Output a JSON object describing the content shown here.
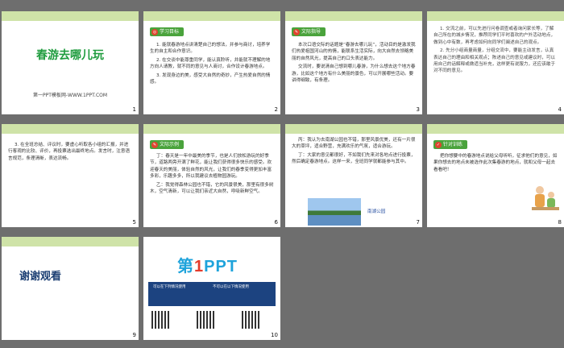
{
  "slides": [
    {
      "num": "1",
      "title": "春游去哪儿玩",
      "subtitle": "第一PPT模板网-WWW.1PPT.COM"
    },
    {
      "num": "2",
      "badge": "学习目标",
      "paras": [
        "1. 能就春游地点讲清楚自己的想法，并参与商讨，培养学生的自主和合作意识。",
        "2. 在交谈中能尊重同学，能认真聆听，并能就不理解的地方向人请教，就不同的意见与人商讨，合作设计春游地点。",
        "3. 发现身边的美，感受大自然的奇妙，产生热爱自然的情感。"
      ]
    },
    {
      "num": "3",
      "badge": "文际指导",
      "paras": [
        "本次口语交际的话题是“春游去哪儿玩”，活动目的是激发我们热爱祖国河山的热情，能联系生活实际，向大自然去领略美丽的自然风光，提高自己的口头表达能力。",
        "交流时，要说清自己想到哪儿春游，为什么想去这个地方春游，比如这个地方有什么美丽的景色，可以开展哪些活动。要讲得细致，有条理。"
      ]
    },
    {
      "num": "4",
      "paras": [
        "1. 交流之前，可以先进行问卷调查或者询问家长等，了解自己所在的城乡情况，推荐同学们平时喜欢的户外活动地点，做到心中有数，再考虑如何向同学们阐述自己的观点。",
        "2. 先分小组商量商量，分组交流中，要能主动发言，认真表达自己的理由和相关观点；陈述自己的意见或建议时，可以用自己的话解释或做适当补充，这样更有说服力，还应该敢于对不同的意见。"
      ]
    },
    {
      "num": "5",
      "paras": [
        "3. 在全班总结、评议时，要虚心听取各小组的汇报，并进行客观的比较、评价，再投票选出最终地点。发言时，注意语言规范，条理清晰，表达流畅。"
      ]
    },
    {
      "num": "6",
      "badge": "文际示例",
      "paras": [
        "丁：春天是一年中最美的季节，也是人们放松游玩的好季节，道路两旁开满了鲜花，能让我们获得很多快乐的感受。欢迎春天的美丽，体验自然的风光，让我们的春季变得更加丰富多彩，乐趣多多，所以我建议去植物园游玩。",
        "乙：我觉得森林公园也不错，它的风景很美，那里有很多树木，空气清新，可以让我们亲近大自然，呼吸新鲜空气。"
      ]
    },
    {
      "num": "7",
      "paras": [
        "丙：我认为去南湖公园也不错，那里风景优美，还有一片很大的草坪，适合野营，充满欢乐的气氛，适合游玩。",
        "丁：大家的意见都很好，不如我们先来对各地点进行投票，然后确定春游地点。这样一来，全班同学就都能参与其中。"
      ],
      "caption": "南湖公园"
    },
    {
      "num": "8",
      "badge": "针对训练",
      "paras": [
        "把你想要中的春游地点说给父母听听，征求他们的意见，如果你想去的地点未被选作此次集春游的地点，就和父母一起去看看吧！"
      ]
    },
    {
      "num": "9",
      "title": "谢谢观看"
    },
    {
      "num": "10",
      "logo_main": "第",
      "logo_num": "1",
      "logo_tail": "PPT",
      "left_label": "可以在下列情况使用",
      "right_label": "不可以在以下情况使用"
    }
  ],
  "colors": {
    "accent": "#cfe3a8",
    "green": "#4aa33c",
    "title_green": "#1f9c3e",
    "navy": "#1c3f73"
  }
}
